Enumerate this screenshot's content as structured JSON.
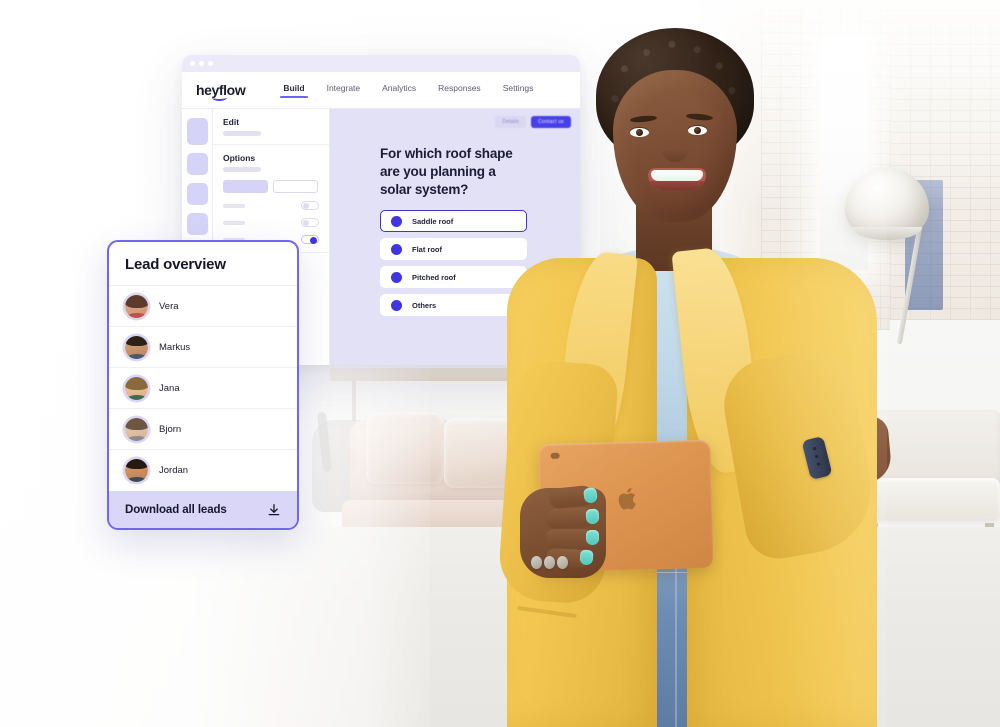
{
  "app": {
    "window_title_dots": 3,
    "logo": "heyflow",
    "nav": [
      {
        "label": "Build",
        "active": true
      },
      {
        "label": "Integrate",
        "active": false
      },
      {
        "label": "Analytics",
        "active": false
      },
      {
        "label": "Responses",
        "active": false
      },
      {
        "label": "Settings",
        "active": false
      }
    ],
    "sidebar": {
      "sections": [
        {
          "title": "Edit"
        },
        {
          "title": "Options"
        }
      ]
    },
    "preview": {
      "secondary_button": "Details",
      "primary_button": "Contact us",
      "question": "For which roof shape are you planning a solar system?",
      "options": [
        {
          "label": "Saddle roof",
          "selected": true
        },
        {
          "label": "Flat roof",
          "selected": false
        },
        {
          "label": "Pitched roof",
          "selected": false
        },
        {
          "label": "Others",
          "selected": false
        }
      ]
    }
  },
  "lead_card": {
    "title": "Lead overview",
    "leads": [
      {
        "name": "Vera"
      },
      {
        "name": "Markus"
      },
      {
        "name": "Jana"
      },
      {
        "name": "Bjorn"
      },
      {
        "name": "Jordan"
      }
    ],
    "footer": {
      "label": "Download all leads",
      "icon": "download-icon"
    }
  },
  "colors": {
    "brand_indigo": "#3f36e0",
    "card_border": "#6f67ef",
    "footer_bg": "#d9d6f7",
    "preview_bg": "#e3e1f5",
    "tile_lilac": "#d5d3f7",
    "jacket_yellow": "#f3c954",
    "blouse_blue": "#bed7e8",
    "jeans_blue": "#6d8cb3",
    "nail_teal": "#4fc8bb",
    "tablet_orange": "#dd9550"
  },
  "scene": {
    "description": "Office interior background with arc floor lamp, armchair, pale sofa and carpeted floor",
    "subject": "Smiling woman in yellow blazer holding a tablet"
  }
}
